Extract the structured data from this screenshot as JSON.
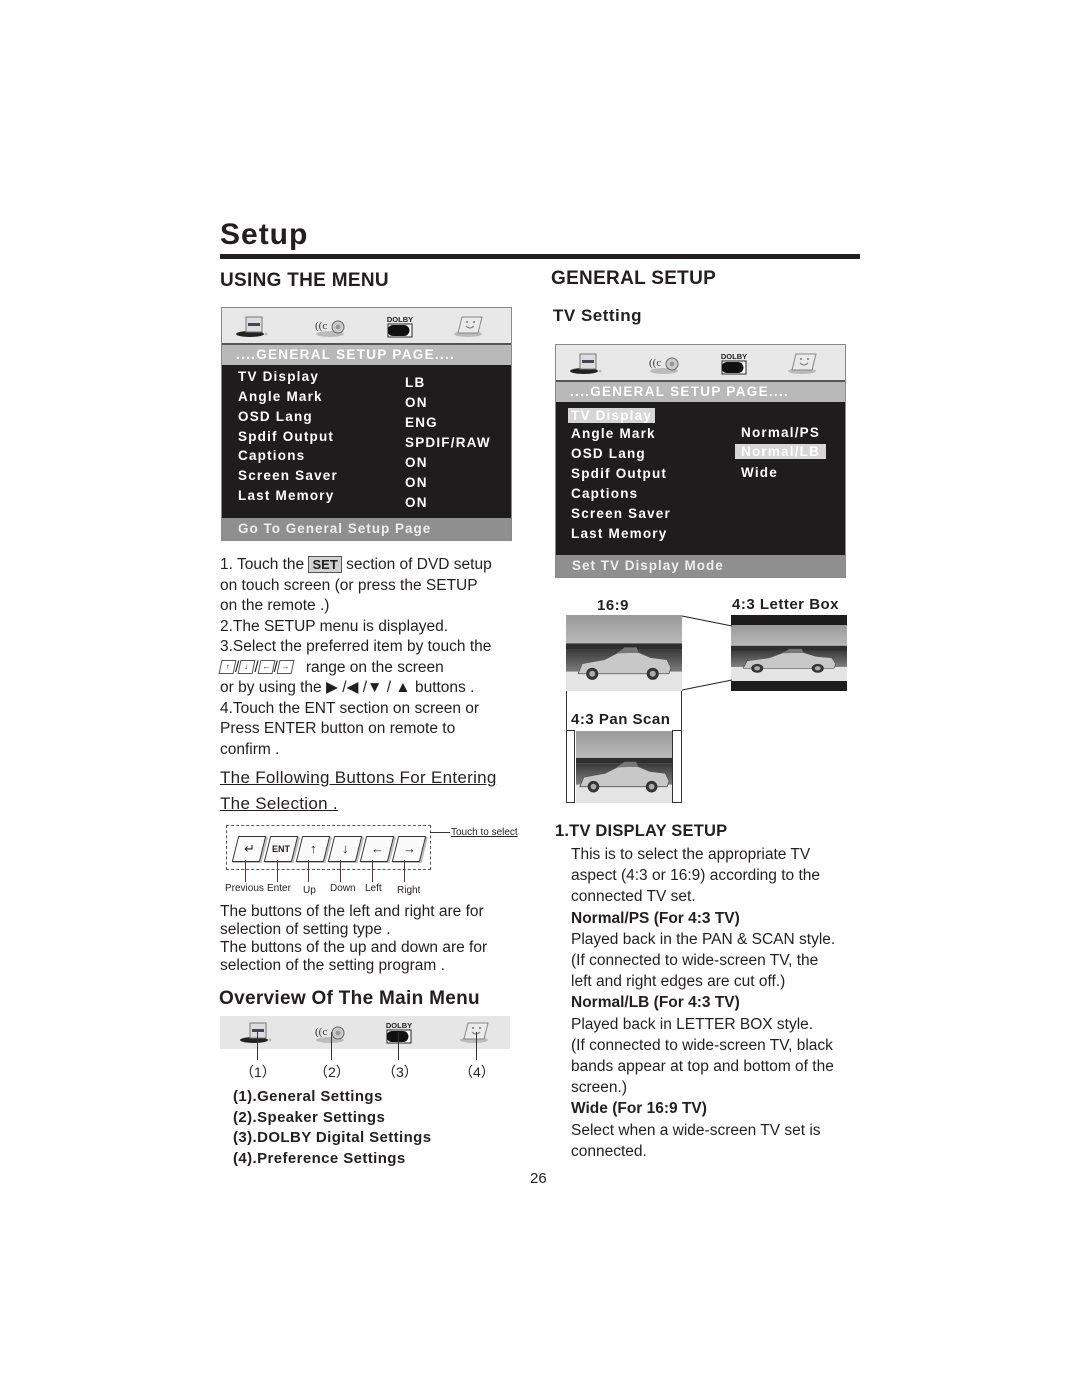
{
  "page": {
    "title": "Setup",
    "page_number": "26"
  },
  "left": {
    "heading": "USING THE MENU",
    "osd": {
      "icons": [
        "general-settings-icon",
        "speaker-settings-icon",
        "dolby-icon",
        "preference-settings-icon"
      ],
      "dolby_label": "DOLBY",
      "header": "....GENERAL SETUP PAGE....",
      "items": [
        {
          "label": "TV Display",
          "value": "LB"
        },
        {
          "label": "Angle Mark",
          "value": "ON"
        },
        {
          "label": "OSD Lang",
          "value": "ENG"
        },
        {
          "label": "Spdif Output",
          "value": "SPDIF/RAW"
        },
        {
          "label": "Captions",
          "value": "ON"
        },
        {
          "label": "Screen Saver",
          "value": "ON"
        },
        {
          "label": "Last Memory",
          "value": "ON"
        }
      ],
      "footer": "Go To General Setup Page"
    },
    "steps": {
      "s1a": "1. Touch the",
      "set_badge": "SET",
      "s1b": "section of DVD setup",
      "s1c": "on touch screen (or press the SETUP",
      "s1d": "on the remote .)",
      "s2": "2.The SETUP menu is displayed.",
      "s3a": "3.Select the preferred item by touch the",
      "s3b_keys": [
        "↑",
        "↓",
        "←",
        "→"
      ],
      "s3b": "range on the screen",
      "s3c": "or by using the ▶ /◀  /▼ / ▲  buttons .",
      "s4a": "4.Touch the ENT section on screen or",
      "s4b": "Press ENTER button on remote to",
      "s4c": "confirm ."
    },
    "following": {
      "line1": "The Following Buttons For Entering",
      "line2": "The  Selection ."
    },
    "buttons_diagram": {
      "touch_label": "Touch to select",
      "keys": [
        {
          "glyph": "↵",
          "label": "Previous"
        },
        {
          "glyph": "ENT",
          "label": "Enter"
        },
        {
          "glyph": "↑",
          "label": "Up"
        },
        {
          "glyph": "↓",
          "label": "Down"
        },
        {
          "glyph": "←",
          "label": "Left"
        },
        {
          "glyph": "→",
          "label": "Right"
        }
      ]
    },
    "buttons_note": [
      "The buttons of the left and right are for",
      "selection of setting type .",
      "The buttons of the up and down are for",
      "selection of the setting program ."
    ],
    "overview": {
      "heading": "Overview Of The Main Menu",
      "numbers": [
        "（1）",
        "（2）",
        "（3）",
        "（4）"
      ],
      "items": [
        "(1).General Settings",
        "(2).Speaker Settings",
        "(3).DOLBY Digital Settings",
        "(4).Preference Settings"
      ]
    }
  },
  "right": {
    "heading": "GENERAL SETUP",
    "subheading": "TV Setting",
    "osd": {
      "dolby_label": "DOLBY",
      "header": "....GENERAL SETUP PAGE....",
      "items": [
        "TV Display",
        "Angle Mark",
        "OSD Lang",
        "Spdif Output",
        "Captions",
        "Screen Saver",
        "Last Memory"
      ],
      "selected_item": "TV Display",
      "options": [
        "Normal/PS",
        "Normal/LB",
        "Wide"
      ],
      "selected_option": "Normal/LB",
      "footer": "Set TV Display Mode"
    },
    "aspect": {
      "wide_label": "16:9",
      "letterbox_label": "4:3 Letter Box",
      "panscan_label": "4:3 Pan Scan"
    },
    "tv_display": {
      "heading": "1.TV DISPLAY SETUP",
      "intro": [
        "This is to select the appropriate TV",
        "aspect (4:3 or 16:9) according to the",
        "connected TV set."
      ],
      "ps_title": "Normal/PS (For 4:3 TV)",
      "ps_desc": [
        "Played back in the PAN & SCAN style.",
        "(If connected to wide-screen TV, the",
        "left and right edges are cut off.)"
      ],
      "lb_title": "Normal/LB (For 4:3 TV)",
      "lb_desc": [
        "Played back in LETTER BOX style.",
        "(If connected to wide-screen TV, black",
        "bands appear at top and bottom of the",
        "screen.)"
      ],
      "wide_title": "Wide (For 16:9 TV)",
      "wide_desc": [
        "Select when a wide-screen TV set is",
        "connected."
      ]
    }
  }
}
